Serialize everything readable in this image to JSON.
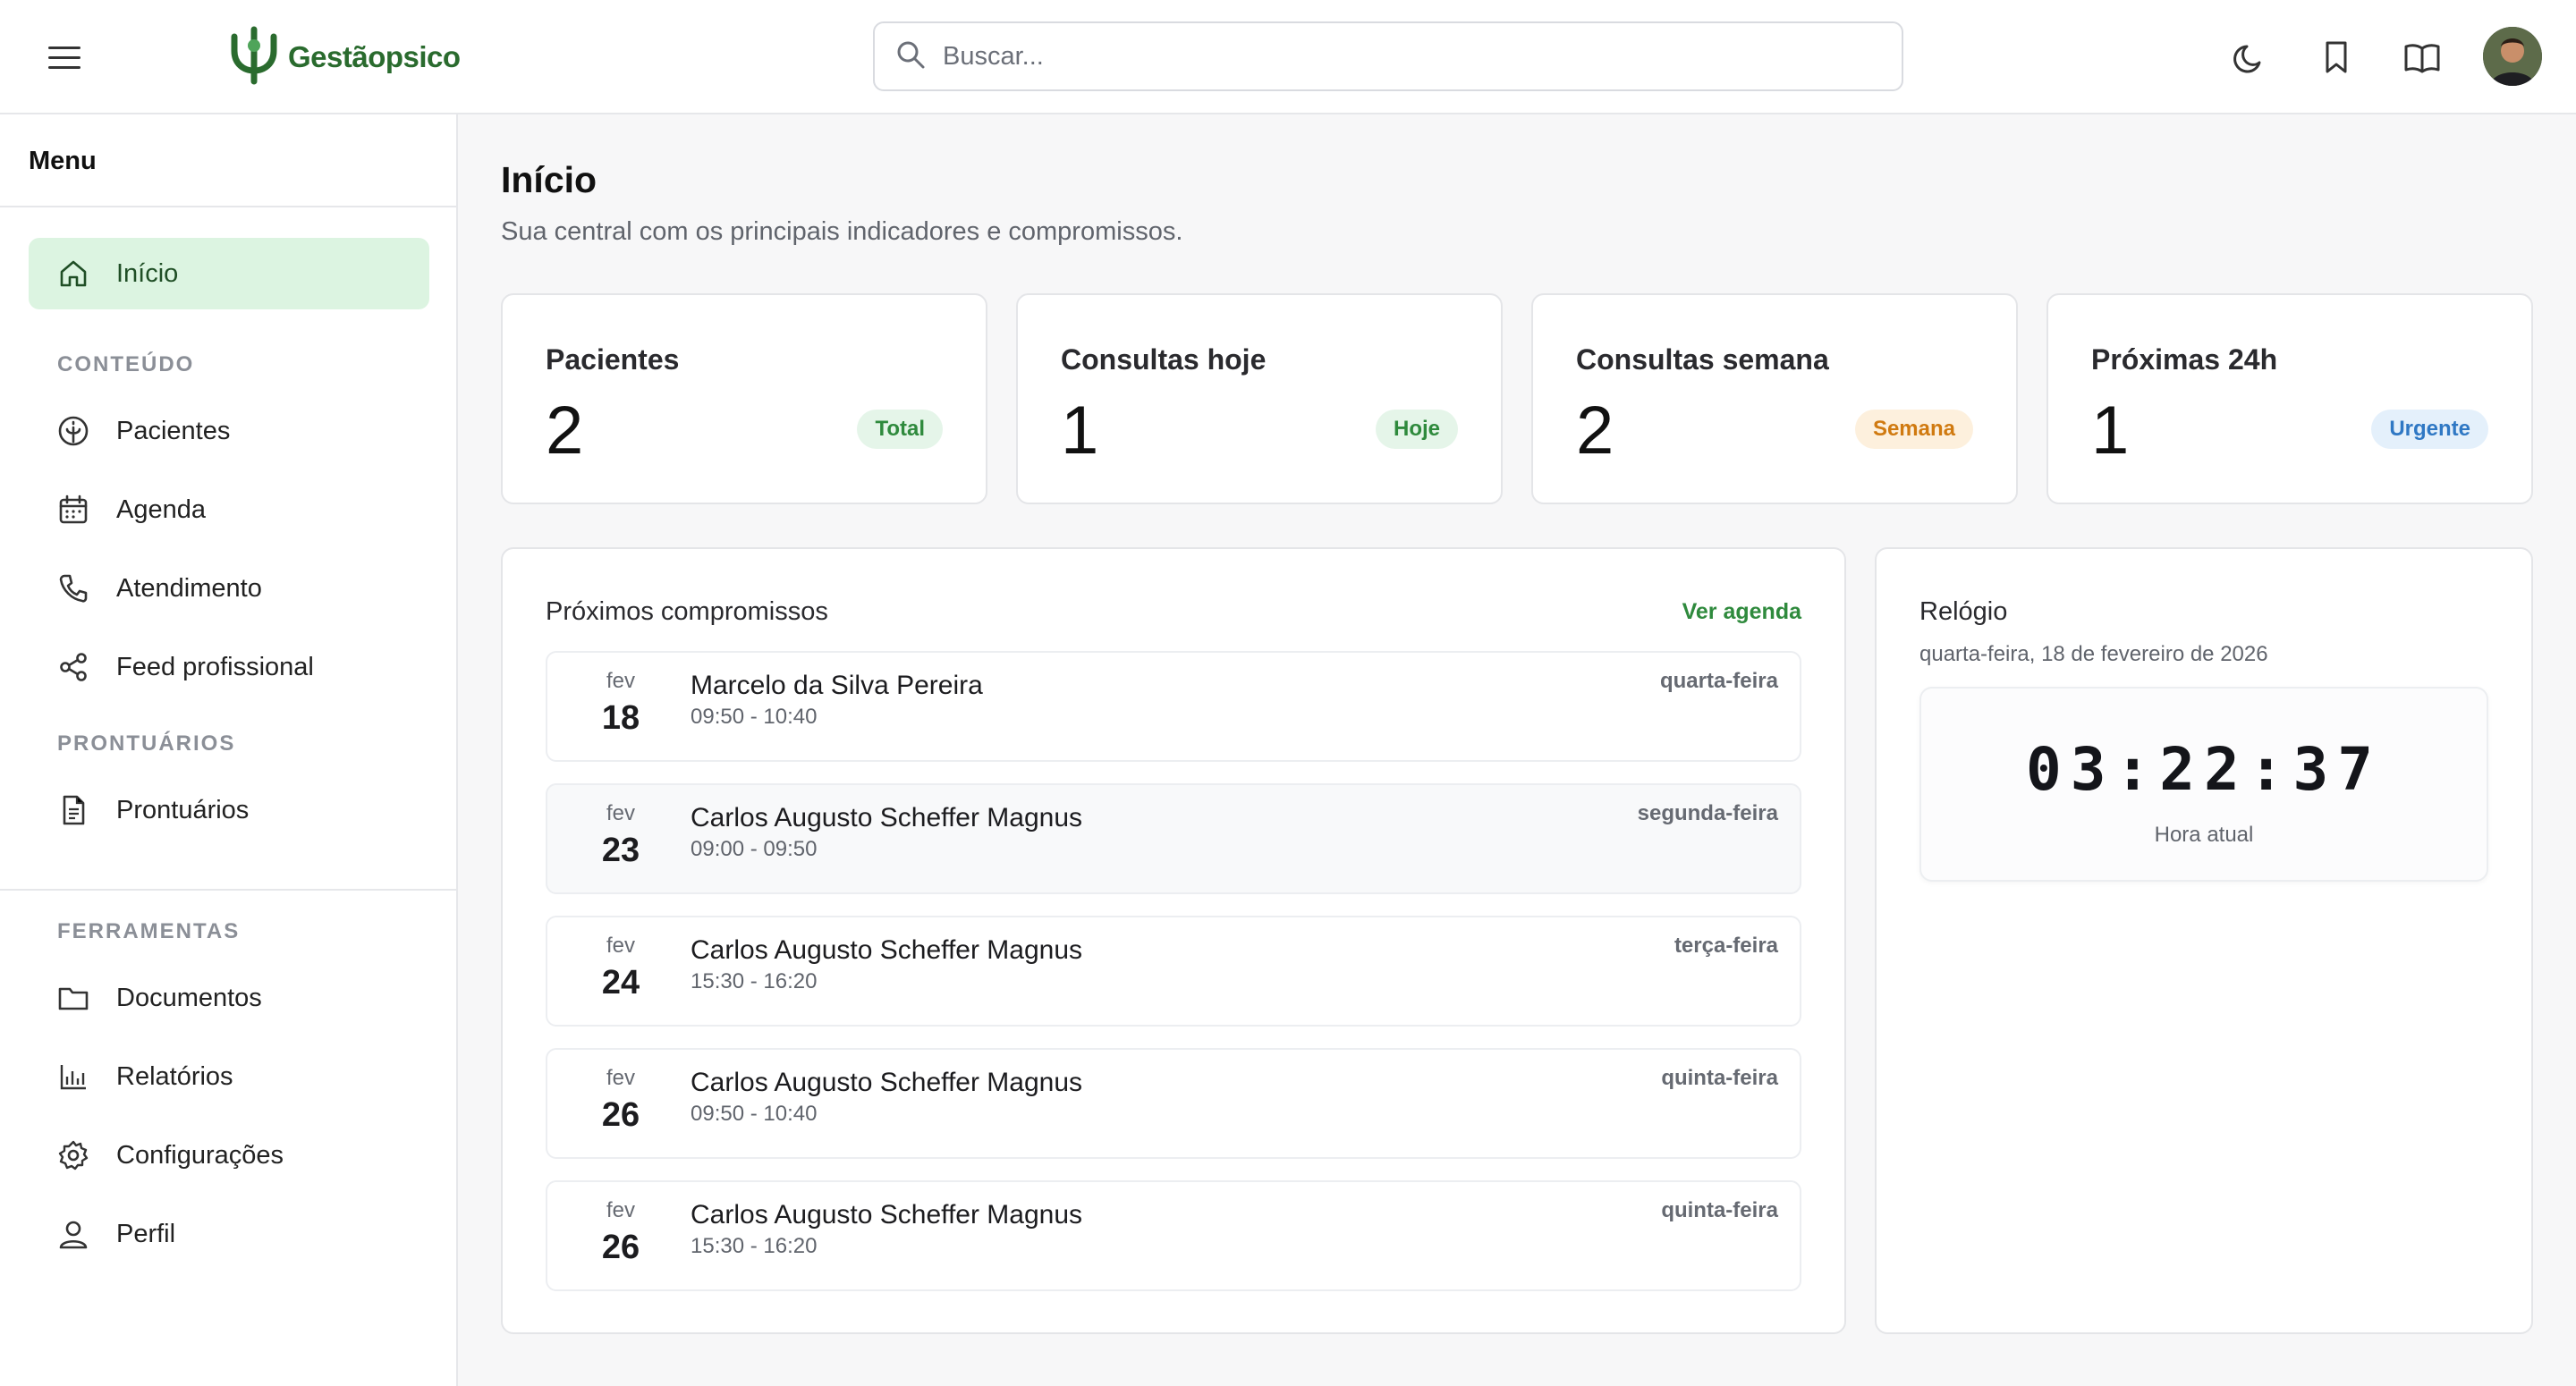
{
  "header": {
    "logo_text": "Gestãopsico",
    "search_placeholder": "Buscar...",
    "icons": [
      "menu-icon",
      "search-icon",
      "moon-icon",
      "bookmark-icon",
      "book-icon"
    ]
  },
  "sidebar": {
    "title": "Menu",
    "home": {
      "label": "Início",
      "icon": "home-icon"
    },
    "sections": {
      "conteudo": "CONTEÚDO",
      "prontuarios": "PRONTUÁRIOS",
      "ferramentas": "FERRAMENTAS"
    },
    "items": {
      "pacientes": "Pacientes",
      "agenda": "Agenda",
      "atendimento": "Atendimento",
      "feed": "Feed profissional",
      "prontuarios": "Prontuários",
      "documentos": "Documentos",
      "relatorios": "Relatórios",
      "configuracoes": "Configurações",
      "perfil": "Perfil"
    }
  },
  "main": {
    "title": "Início",
    "subtitle": "Sua central com os principais indicadores e compromissos.",
    "stats": [
      {
        "label": "Pacientes",
        "value": "2",
        "badge": "Total"
      },
      {
        "label": "Consultas hoje",
        "value": "1",
        "badge": "Hoje"
      },
      {
        "label": "Consultas semana",
        "value": "2",
        "badge": "Semana"
      },
      {
        "label": "Próximas 24h",
        "value": "1",
        "badge": "Urgente"
      }
    ],
    "appointments_panel": {
      "title": "Próximos compromissos",
      "link": "Ver agenda",
      "items": [
        {
          "month": "fev",
          "day": "18",
          "name": "Marcelo da Silva Pereira",
          "time": "09:50 - 10:40",
          "weekday": "quarta-feira"
        },
        {
          "month": "fev",
          "day": "23",
          "name": "Carlos Augusto Scheffer Magnus",
          "time": "09:00 - 09:50",
          "weekday": "segunda-feira"
        },
        {
          "month": "fev",
          "day": "24",
          "name": "Carlos Augusto Scheffer Magnus",
          "time": "15:30 - 16:20",
          "weekday": "terça-feira"
        },
        {
          "month": "fev",
          "day": "26",
          "name": "Carlos Augusto Scheffer Magnus",
          "time": "09:50 - 10:40",
          "weekday": "quinta-feira"
        },
        {
          "month": "fev",
          "day": "26",
          "name": "Carlos Augusto Scheffer Magnus",
          "time": "15:30 - 16:20",
          "weekday": "quinta-feira"
        }
      ]
    },
    "clock_panel": {
      "title": "Relógio",
      "date": "quarta-feira, 18 de fevereiro de 2026",
      "time": "03:22:37",
      "caption": "Hora atual"
    }
  },
  "colors": {
    "brand": "#2a6b2e",
    "active_nav_bg": "#dcf4e1",
    "badge_green": "#2f8a3d",
    "badge_orange": "#d07a10",
    "badge_blue": "#2f78c4"
  }
}
